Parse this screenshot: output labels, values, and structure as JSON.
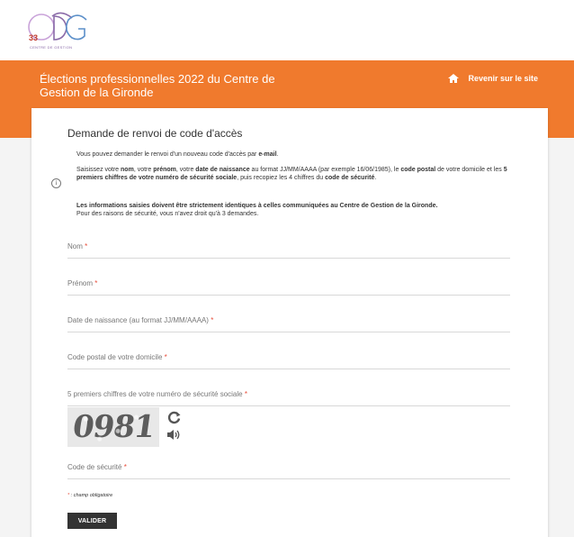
{
  "logo": {
    "number": "33",
    "subtitle": "CENTRE DE GESTION"
  },
  "header": {
    "title": "Élections professionnelles 2022 du Centre de Gestion de la Gironde",
    "back_link": "Revenir sur le site",
    "back_icon": "home-icon"
  },
  "form": {
    "title": "Demande de renvoi de code d'accès",
    "info_icon": "info-icon",
    "info": {
      "line1_a": "Vous pouvez demander le renvoi d'un nouveau code d'accès par ",
      "line1_b": "e-mail",
      "line1_c": ".",
      "p2_a": "Saisissez votre ",
      "p2_b": "nom",
      "p2_c": ", votre ",
      "p2_d": "prénom",
      "p2_e": ", votre ",
      "p2_f": "date de naissance",
      "p2_g": " au format JJ/MM/AAAA (par exemple 16/06/1985), le ",
      "p2_h": "code postal",
      "p2_i": " de votre domicile et les ",
      "p2_j": "5 premiers chiffres de votre numéro de sécurité sociale",
      "p2_k": ", puis recopiez les 4 chiffres du ",
      "p2_l": "code de sécurité",
      "p2_m": ".",
      "p3_a": "Les informations saisies doivent être strictement identiques à celles communiquées au Centre de Gestion de la Gironde.",
      "p3_b": "Pour des raisons de sécurité, vous n'avez droit qu'à 3 demandes."
    },
    "fields": {
      "nom": "Nom",
      "prenom": "Prénom",
      "naissance": "Date de naissance (au format JJ/MM/AAAA)",
      "cp": "Code postal de votre domicile",
      "secu": "5 premiers chiffres de votre numéro de sécurité sociale",
      "code": "Code de sécurité"
    },
    "required_mark": "*",
    "captcha_text": "0981",
    "captcha_refresh_icon": "refresh-icon",
    "captcha_audio_icon": "speaker-icon",
    "required_note_mark": "*",
    "required_note": " : champ obligatoire",
    "submit": "VALIDER"
  },
  "colors": {
    "brand_orange": "#f07a2d",
    "required_red": "#e84d3a",
    "button_dark": "#333333"
  }
}
